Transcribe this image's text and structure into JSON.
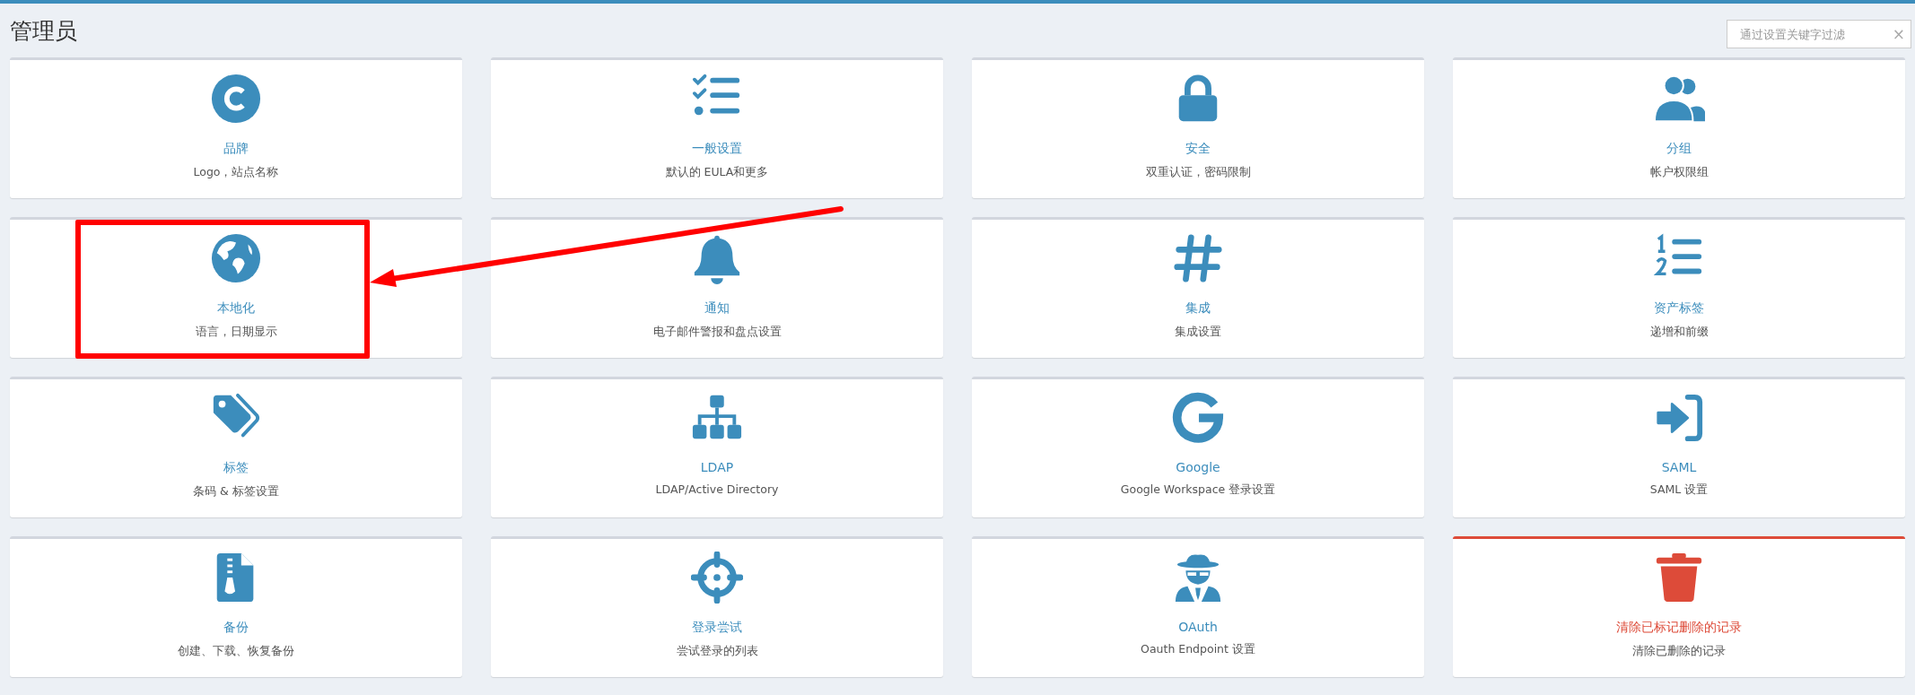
{
  "page_title": "管理员",
  "search": {
    "placeholder": "通过设置关键字过滤",
    "clear": "×"
  },
  "cards": [
    {
      "title": "品牌",
      "description": "Logo，站点名称",
      "kind": "normal",
      "highlighted": false
    },
    {
      "title": "一般设置",
      "description": "默认的 EULA和更多",
      "kind": "normal",
      "highlighted": false
    },
    {
      "title": "安全",
      "description": "双重认证，密码限制",
      "kind": "normal",
      "highlighted": false
    },
    {
      "title": "分组",
      "description": "帐户权限组",
      "kind": "normal",
      "highlighted": false
    },
    {
      "title": "本地化",
      "description": "语言，日期显示",
      "kind": "normal",
      "highlighted": true
    },
    {
      "title": "通知",
      "description": "电子邮件警报和盘点设置",
      "kind": "normal",
      "highlighted": false
    },
    {
      "title": "集成",
      "description": "集成设置",
      "kind": "normal",
      "highlighted": false
    },
    {
      "title": "资产标签",
      "description": "递增和前缀",
      "kind": "normal",
      "highlighted": false
    },
    {
      "title": "标签",
      "description": "条码 & 标签设置",
      "kind": "normal",
      "highlighted": false
    },
    {
      "title": "LDAP",
      "description": "LDAP/Active Directory",
      "kind": "normal",
      "highlighted": false
    },
    {
      "title": "Google",
      "description": "Google Workspace 登录设置",
      "kind": "normal",
      "highlighted": false
    },
    {
      "title": "SAML",
      "description": "SAML 设置",
      "kind": "normal",
      "highlighted": false
    },
    {
      "title": "备份",
      "description": "创建、下载、恢复备份",
      "kind": "normal",
      "highlighted": false
    },
    {
      "title": "登录尝试",
      "description": "尝试登录的列表",
      "kind": "normal",
      "highlighted": false
    },
    {
      "title": "OAuth",
      "description": "Oauth Endpoint 设置",
      "kind": "normal",
      "highlighted": false
    },
    {
      "title": "清除已标记删除的记录",
      "description": "清除已删除的记录",
      "kind": "danger",
      "highlighted": false
    }
  ]
}
